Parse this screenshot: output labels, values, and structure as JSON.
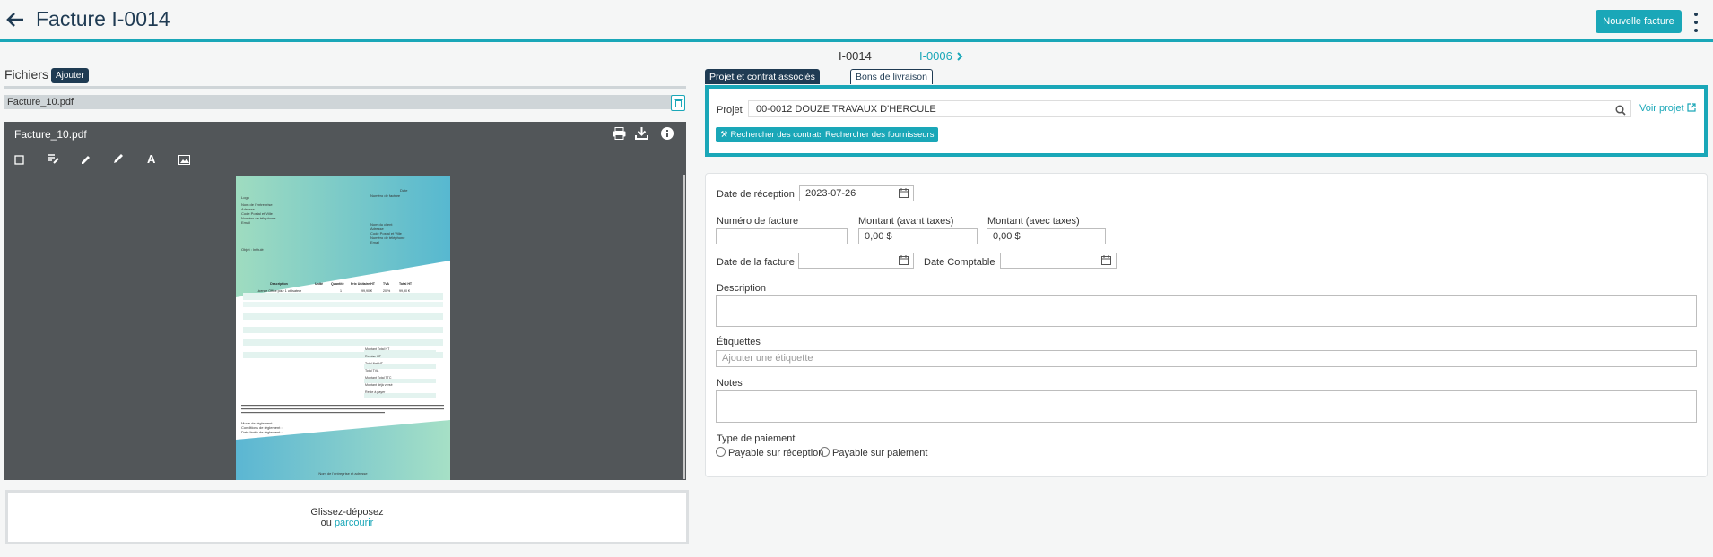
{
  "header": {
    "title": "Facture I-0014",
    "new_invoice_label": "Nouvelle facture"
  },
  "files": {
    "label": "Fichiers",
    "add_label": "Ajouter",
    "file_name": "Facture_10.pdf",
    "viewer_title": "Facture_10.pdf",
    "dropzone_text": "Glissez-déposez",
    "dropzone_or": "ou ",
    "dropzone_link": "parcourir"
  },
  "pdf": {
    "logo": "Logo",
    "date": "Date",
    "invoice_number": "Numéro de facture",
    "company_lines": [
      "Nom de l'entreprise",
      "Adresse",
      "Code Postal et Ville",
      "Numéro de téléphone",
      "Email"
    ],
    "client_lines": [
      "Nom du client",
      "Adresse",
      "Code Postal et Ville",
      "Numéro de téléphone",
      "Email"
    ],
    "object": "Objet : Intitulé",
    "table_headers": [
      "Description",
      "Unité",
      "Quantité",
      "Prix Unitaire HT",
      "TVA",
      "Total HT"
    ],
    "table_row": [
      "Licence Office pour 1 utilisateur",
      "",
      "1",
      "99,90 €",
      "20 %",
      "99,90 €"
    ],
    "totals": [
      "Montant Total HT",
      "Remise HT",
      "Total Net HT",
      "Total TVA",
      "Montant Total TTC",
      "Montant déjà versé",
      "Reste à payer"
    ],
    "payment_lines": [
      "Mode de règlement :",
      "Conditions de règlement :",
      "Date limite de règlement :"
    ],
    "footer": "Nom de l'entreprise et adresse"
  },
  "invoice_nav": {
    "current": "I-0014",
    "next": "I-0006"
  },
  "tabs": [
    {
      "label": "Projet et contrat associés",
      "active": true
    },
    {
      "label": "Bons de livraison",
      "active": false
    }
  ],
  "project": {
    "label": "Projet",
    "value": "00-0012 DOUZE TRAVAUX D'HERCULE",
    "view_link": "Voir projet",
    "search_contracts": "Rechercher des contrats",
    "search_suppliers": "Rechercher des fournisseurs"
  },
  "form": {
    "reception_date_label": "Date de réception",
    "reception_date_value": "2023-07-26",
    "invoice_number_label": "Numéro de facture",
    "invoice_number_value": "",
    "amount_before_tax_label": "Montant (avant taxes)",
    "amount_before_tax_value": "0,00 $",
    "amount_with_tax_label": "Montant (avec taxes)",
    "amount_with_tax_value": "0,00 $",
    "invoice_date_label": "Date de la facture",
    "accounting_date_label": "Date Comptable",
    "description_label": "Description",
    "tags_label": "Étiquettes",
    "tags_placeholder": "Ajouter une étiquette",
    "notes_label": "Notes",
    "payment_type_label": "Type de paiement",
    "payment_options": [
      "Payable sur réception",
      "Payable sur paiement"
    ]
  },
  "colors": {
    "accent": "#1aa7b8",
    "navy": "#1f3b53",
    "viewer_bg": "#525659"
  }
}
